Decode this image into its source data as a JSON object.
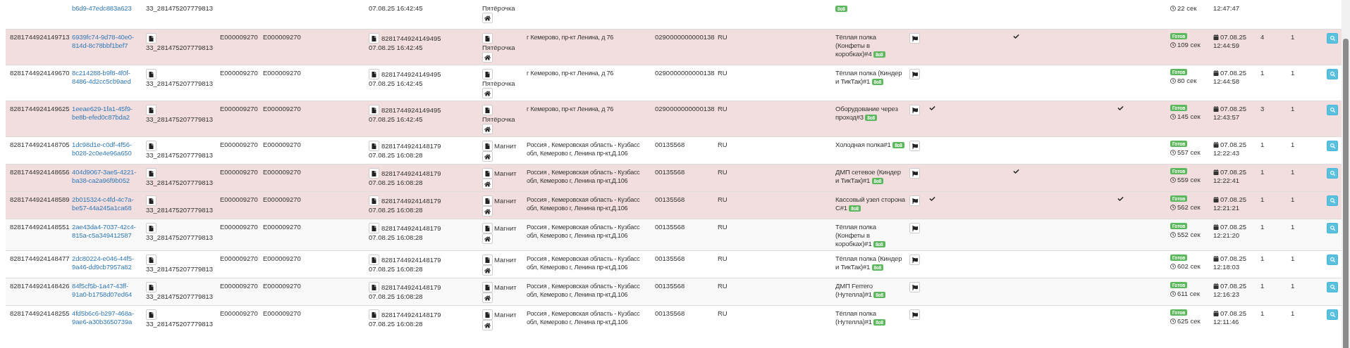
{
  "rows": [
    {
      "kind": "partial",
      "highlight": false,
      "uuid": "b6d9-47edc883a623",
      "doc_number": "33_281475207779813",
      "barcode_date": "07.08.25 16:42:45",
      "store": "Пятёрочка",
      "badge": "8o8",
      "duration": "22 сек",
      "time": "12:47:47"
    },
    {
      "kind": "full",
      "highlight": true,
      "id": "8281744924149713",
      "uuid": "6939fc74-9d78-40e0-814d-8c78bbf1bef7",
      "doc_number": "33_281475207779813",
      "code_1": "E000009270",
      "code_2": "E000009270",
      "barcode": "8281744924149495",
      "barcode_date": "07.08.25 16:42:45",
      "store": "Пятёрочка",
      "address": "г Кемерово, пр-кт Ленина, д 76",
      "store_code": "0290000000000138",
      "country": "RU",
      "equipment": "Тёплая полка (Конфеты в коробках)#4",
      "badge": "8o8",
      "checks": [
        false,
        true,
        false
      ],
      "status": "Готов",
      "duration": "109 сек",
      "date": "07.08.25",
      "time": "12:44:59",
      "count_1": "4",
      "count_2": "1"
    },
    {
      "kind": "full",
      "highlight": false,
      "id": "8281744924149670",
      "uuid": "8c214288-b9f8-4f0f-8486-4d2cc5cb9aed",
      "doc_number": "33_281475207779813",
      "code_1": "E000009270",
      "code_2": "E000009270",
      "barcode": "8281744924149495",
      "barcode_date": "07.08.25 16:42:45",
      "store": "Пятёрочка",
      "address": "г Кемерово, пр-кт Ленина, д 76",
      "store_code": "0290000000000138",
      "country": "RU",
      "equipment": "Тёплая полка (Киндер и ТикТак)#1",
      "badge": "8o8",
      "checks": [
        false,
        false,
        false
      ],
      "status": "Готов",
      "duration": "80 сек",
      "date": "07.08.25",
      "time": "12:44:58",
      "count_1": "1",
      "count_2": "1"
    },
    {
      "kind": "full",
      "highlight": true,
      "id": "8281744924149625",
      "uuid": "1eeae629-1fa1-45f9-be8b-efed0c87bda2",
      "doc_number": "33_281475207779813",
      "code_1": "E000009270",
      "code_2": "E000009270",
      "barcode": "8281744924149495",
      "barcode_date": "07.08.25 16:42:45",
      "store": "Пятёрочка",
      "address": "г Кемерово, пр-кт Ленина, д 76",
      "store_code": "0290000000000138",
      "country": "RU",
      "equipment": "Оборудование через проход#3",
      "badge": "8o8",
      "checks": [
        true,
        false,
        true
      ],
      "status": "Готов",
      "duration": "145 сек",
      "date": "07.08.25",
      "time": "12:43:57",
      "count_1": "3",
      "count_2": "1"
    },
    {
      "kind": "full",
      "highlight": false,
      "id": "8281744924148705",
      "uuid": "1dc98d1e-c0df-4f56-b028-2c0e4e96a650",
      "doc_number": "33_281475207779813",
      "code_1": "E000009270",
      "code_2": "E000009270",
      "barcode": "8281744924148179",
      "barcode_date": "07.08.25 16:08:28",
      "store": "Магнит",
      "address": "Россия , Кемеровская область - Кузбасс обл, Кемерово г, Ленина пр-кт,Д.106",
      "store_code": "00135568",
      "country": "RU",
      "equipment": "Холодная полка#1",
      "badge": "8o8",
      "checks": [
        false,
        false,
        false
      ],
      "status": "Готов",
      "duration": "557 сек",
      "date": "07.08.25",
      "time": "12:22:43",
      "count_1": "1",
      "count_2": "1"
    },
    {
      "kind": "full",
      "highlight": true,
      "id": "8281744924148656",
      "uuid": "404d9067-3ae5-4221-ba38-ca2a96f9b052",
      "doc_number": "33_281475207779813",
      "code_1": "E000009270",
      "code_2": "E000009270",
      "barcode": "8281744924148179",
      "barcode_date": "07.08.25 16:08:28",
      "store": "Магнит",
      "address": "Россия , Кемеровская область - Кузбасс обл, Кемерово г, Ленина пр-кт,Д.106",
      "store_code": "00135568",
      "country": "RU",
      "equipment": "ДМП сетевое (Киндер и ТикТак)#1",
      "badge": "8o8",
      "checks": [
        false,
        true,
        false
      ],
      "status": "Готов",
      "duration": "559 сек",
      "date": "07.08.25",
      "time": "12:22:41",
      "count_1": "1",
      "count_2": "1"
    },
    {
      "kind": "full",
      "highlight": true,
      "id": "8281744924148589",
      "uuid": "2b015324-c4fd-4c7a-be57-44a245a1ca68",
      "doc_number": "33_281475207779813",
      "code_1": "E000009270",
      "code_2": "E000009270",
      "barcode": "8281744924148179",
      "barcode_date": "07.08.25 16:08:28",
      "store": "Магнит",
      "address": "Россия , Кемеровская область - Кузбасс обл, Кемерово г, Ленина пр-кт,Д.106",
      "store_code": "00135568",
      "country": "RU",
      "equipment": "Кассовый узел сторона С#1",
      "badge": "8o8",
      "checks": [
        true,
        false,
        true
      ],
      "status": "Готов",
      "duration": "562 сек",
      "date": "07.08.25",
      "time": "12:21:21",
      "count_1": "1",
      "count_2": "1"
    },
    {
      "kind": "full",
      "highlight": false,
      "id": "8281744924148551",
      "uuid": "2ae43da4-7037-42c4-815a-c5a349412587",
      "doc_number": "33_281475207779813",
      "code_1": "E000009270",
      "code_2": "E000009270",
      "barcode": "8281744924148179",
      "barcode_date": "07.08.25 16:08:28",
      "store": "Магнит",
      "address": "Россия , Кемеровская область - Кузбасс обл, Кемерово г, Ленина пр-кт,Д.106",
      "store_code": "00135568",
      "country": "RU",
      "equipment": "Тёплая полка (Конфеты в коробках)#1",
      "badge": "8o8",
      "checks": [
        false,
        false,
        false
      ],
      "status": "Готов",
      "duration": "552 сек",
      "date": "07.08.25",
      "time": "12:21:20",
      "count_1": "1",
      "count_2": "1"
    },
    {
      "kind": "full",
      "highlight": false,
      "id": "8281744924148477",
      "uuid": "2dc80224-e046-44f5-9a46-dd9cb7957a82",
      "doc_number": "33_281475207779813",
      "code_1": "E000009270",
      "code_2": "E000009270",
      "barcode": "8281744924148179",
      "barcode_date": "07.08.25 16:08:28",
      "store": "Магнит",
      "address": "Россия , Кемеровская область - Кузбасс обл, Кемерово г, Ленина пр-кт,Д.106",
      "store_code": "00135568",
      "country": "RU",
      "equipment": "Тёплая полка (Киндер и ТикТак)#1",
      "badge": "8o8",
      "checks": [
        false,
        false,
        false
      ],
      "status": "Готов",
      "duration": "602 сек",
      "date": "07.08.25",
      "time": "12:18:03",
      "count_1": "1",
      "count_2": "1"
    },
    {
      "kind": "full",
      "highlight": false,
      "id": "8281744924148426",
      "uuid": "84f5cf5b-1a47-43ff-91a0-b1758d07ed64",
      "doc_number": "33_281475207779813",
      "code_1": "E000009270",
      "code_2": "E000009270",
      "barcode": "8281744924148179",
      "barcode_date": "07.08.25 16:08:28",
      "store": "Магнит",
      "address": "Россия , Кемеровская область - Кузбасс обл, Кемерово г, Ленина пр-кт,Д.106",
      "store_code": "00135568",
      "country": "RU",
      "equipment": "ДМП Ferrero (Нутелла)#1",
      "badge": "8o8",
      "checks": [
        false,
        false,
        false
      ],
      "status": "Готов",
      "duration": "611 сек",
      "date": "07.08.25",
      "time": "12:16:23",
      "count_1": "1",
      "count_2": "1"
    },
    {
      "kind": "full",
      "highlight": false,
      "id": "8281744924148255",
      "uuid": "4fd5b6c6-b297-468a-9ae6-a30b3650739a",
      "doc_number": "33_281475207779813",
      "code_1": "E000009270",
      "code_2": "E000009270",
      "barcode": "8281744924148179",
      "barcode_date": "07.08.25 16:08:28",
      "store": "Магнит",
      "address": "Россия , Кемеровская область - Кузбасс обл, Кемерово г, Ленина пр-кт,Д.106",
      "store_code": "00135568",
      "country": "RU",
      "equipment": "Тёплая полка (Нутелла)#1",
      "badge": "8o8",
      "checks": [
        false,
        false,
        false
      ],
      "status": "Готов",
      "duration": "625 сек",
      "date": "07.08.25",
      "time": "12:11:46",
      "count_1": "1",
      "count_2": "1"
    }
  ]
}
